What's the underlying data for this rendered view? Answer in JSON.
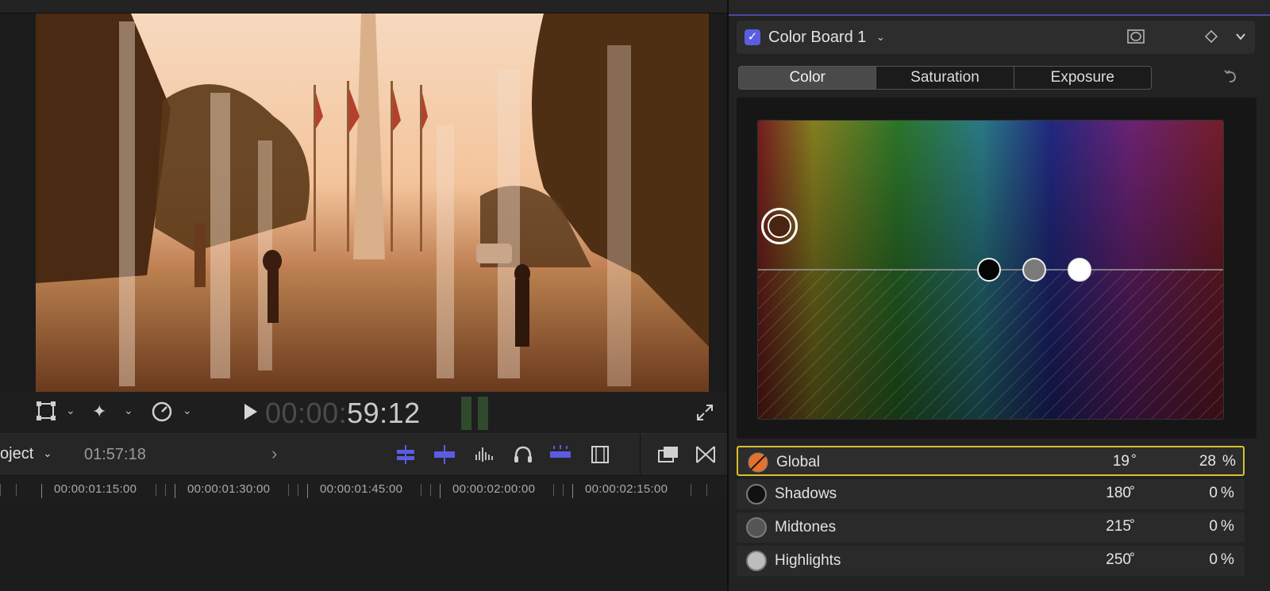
{
  "viewer": {
    "timecode_dim": "00:00:",
    "timecode_bright": "59:12",
    "icons": [
      "transform-icon",
      "enhance-wand-icon",
      "retime-speed-icon",
      "play-icon",
      "fullscreen-icon"
    ]
  },
  "timeline": {
    "project_label": "oject",
    "duration": "01:57:18",
    "ruler": [
      "00:00:01:15:00",
      "00:00:01:30:00",
      "00:00:01:45:00",
      "00:00:02:00:00",
      "00:00:02:15:00"
    ]
  },
  "inspector": {
    "effect": {
      "enabled": true,
      "title": "Color Board 1"
    },
    "tabs": [
      "Color",
      "Saturation",
      "Exposure"
    ],
    "active_tab": "Color",
    "rows": [
      {
        "name": "Global",
        "angle": "19",
        "deg": "°",
        "percent": "28",
        "pct": "%",
        "dot_color": "#e8702a",
        "selected": true
      },
      {
        "name": "Shadows",
        "angle": "180",
        "deg": "°",
        "percent": "0",
        "pct": "%",
        "dot_color": "#111111",
        "selected": false
      },
      {
        "name": "Midtones",
        "angle": "215",
        "deg": "°",
        "percent": "0",
        "pct": "%",
        "dot_color": "#555555",
        "selected": false
      },
      {
        "name": "Highlights",
        "angle": "250",
        "deg": "°",
        "percent": "0",
        "pct": "%",
        "dot_color": "#bdbdbd",
        "selected": false
      }
    ]
  },
  "colors": {
    "accent": "#5b5ce2",
    "selection_border": "#d8c12b",
    "panel": "#222222"
  }
}
